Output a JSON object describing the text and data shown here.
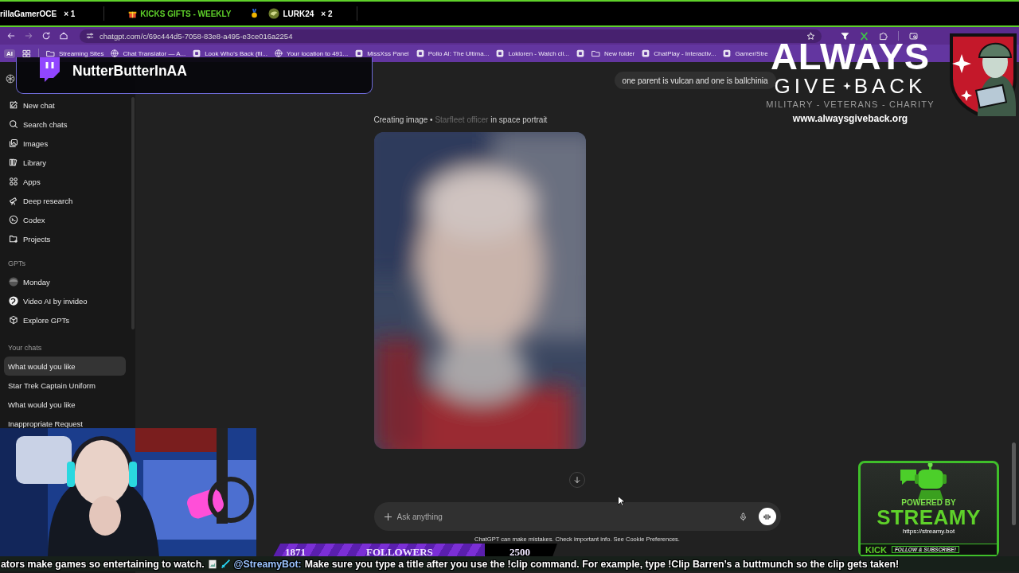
{
  "stream_bar": {
    "items": [
      {
        "kind": "user",
        "text": "rillaGamerOCE",
        "count": "× 1"
      },
      {
        "kind": "goal",
        "text": "KICKS GIFTS - WEEKLY"
      },
      {
        "kind": "lurk",
        "text": "LURK24",
        "count": "× 2"
      }
    ]
  },
  "browser": {
    "url": "chatgpt.com/c/69c444d5-7058-83e8-a495-e3ce016a2254",
    "bookmarks": [
      {
        "kind": "badge",
        "label": "AI"
      },
      {
        "kind": "apps"
      },
      {
        "kind": "folder",
        "label": "Streaming Sites"
      },
      {
        "kind": "globe",
        "label": "Chat Translator — A..."
      },
      {
        "kind": "site",
        "label": "Look Who's Back (fil..."
      },
      {
        "kind": "globe",
        "label": "Your location to 491..."
      },
      {
        "kind": "site",
        "label": "MissXss Panel"
      },
      {
        "kind": "site",
        "label": "Pollo AI: The Ultima..."
      },
      {
        "kind": "site",
        "label": "Lokloren - Watch cli..."
      },
      {
        "kind": "site"
      },
      {
        "kind": "folder",
        "label": "New folder"
      },
      {
        "kind": "site",
        "label": "ChatPlay - Interactiv..."
      },
      {
        "kind": "site",
        "label": "Gamer/Stre"
      }
    ]
  },
  "sidebar": {
    "nav": [
      {
        "kind": "compose",
        "label": "New chat"
      },
      {
        "kind": "search",
        "label": "Search chats"
      },
      {
        "kind": "images",
        "label": "Images"
      },
      {
        "kind": "library",
        "label": "Library"
      },
      {
        "kind": "apps",
        "label": "Apps"
      },
      {
        "kind": "research",
        "label": "Deep research"
      },
      {
        "kind": "codex",
        "label": "Codex"
      },
      {
        "kind": "projects",
        "label": "Projects"
      }
    ],
    "gpts": {
      "heading": "GPTs",
      "items": [
        {
          "kind": "avatar",
          "label": "Monday"
        },
        {
          "kind": "invideo",
          "label": "Video AI by invideo"
        },
        {
          "kind": "cube",
          "label": "Explore GPTs"
        }
      ]
    },
    "chats": {
      "heading": "Your chats",
      "items": [
        {
          "label": "What would you like",
          "selected": true
        },
        {
          "label": "Star Trek Captain Uniform",
          "selected": false
        },
        {
          "label": "What would you like",
          "selected": false
        },
        {
          "label": "Inappropriate Request",
          "selected": false
        }
      ]
    }
  },
  "chat": {
    "user_message": "one parent is vulcan and one is ballchinia",
    "status_line": {
      "label": "Creating image •",
      "faded": "Starfleet officer",
      "rest": "in space portrait"
    },
    "composer": {
      "placeholder": "Ask anything"
    },
    "disclaimer": {
      "text": "ChatGPT can make mistakes. Check important info. See",
      "link": "Cookie Preferences",
      "end": "."
    }
  },
  "overlays": {
    "twitch_name": "NutterButterInAA",
    "sponsor": {
      "word1": "ALWAYS",
      "word2": "GIVE",
      "word3": "BACK",
      "tagline": "MILITARY - VETERANS - CHARITY",
      "url": "www.alwaysgiveback.org"
    },
    "followers": {
      "current": "1871",
      "label": "FOLLOWERS",
      "goal": "2500",
      "level": 0.748
    },
    "streamy": {
      "powered": "POWERED BY",
      "name": "STREAMY",
      "url": "https://streamy.bot",
      "platform": "KICK",
      "cta": "FOLLOW & SUBSCRIBE!"
    },
    "ticker": {
      "before": "ators make games so entertaining to watch.",
      "mention": "@StreamyBot:",
      "message": "Make sure you type a title after you use the !clip command. For example, type !Clip Barren’s a buttmunch so the clip gets taken!"
    }
  }
}
